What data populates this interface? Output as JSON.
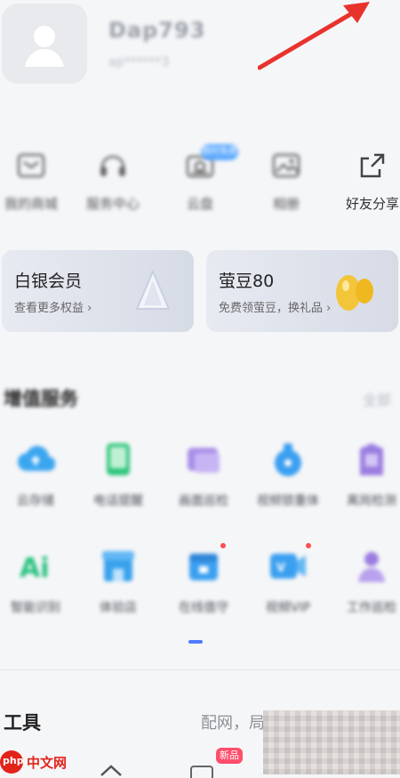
{
  "profile": {
    "name": "Dap793",
    "subtitle": "ap******3"
  },
  "quick_actions": [
    {
      "label": "我的商城",
      "icon": "mail-icon"
    },
    {
      "label": "服务中心",
      "icon": "headset-icon"
    },
    {
      "label": "云盘",
      "icon": "cloud-drive-icon",
      "tag": "限时免费"
    },
    {
      "label": "相册",
      "icon": "photo-icon"
    },
    {
      "label": "好友分享",
      "icon": "share-icon"
    }
  ],
  "cards": [
    {
      "title": "白银会员",
      "subtitle": "查看更多权益 ›"
    },
    {
      "title": "萤豆80",
      "subtitle": "免费领萤豆，换礼品 ›"
    }
  ],
  "value_services": {
    "title": "增值服务",
    "more": "全部",
    "row1": [
      {
        "label": "云存储"
      },
      {
        "label": "电话提醒"
      },
      {
        "label": "画面巡检"
      },
      {
        "label": "视频锁重体"
      },
      {
        "label": "离岗检测"
      }
    ],
    "row2": [
      {
        "label": "智能识别"
      },
      {
        "label": "体验店"
      },
      {
        "label": "在线值守"
      },
      {
        "label": "视频VIP"
      },
      {
        "label": "工作巡检"
      }
    ]
  },
  "tools": {
    "title": "工具",
    "right_text": "配网，局"
  },
  "bottom": {
    "watermark": "中文网",
    "watermark_logo": "php",
    "new_badge": "新品"
  },
  "colors": {
    "accent": "#4f7cff",
    "arrow": "#e8332d"
  }
}
